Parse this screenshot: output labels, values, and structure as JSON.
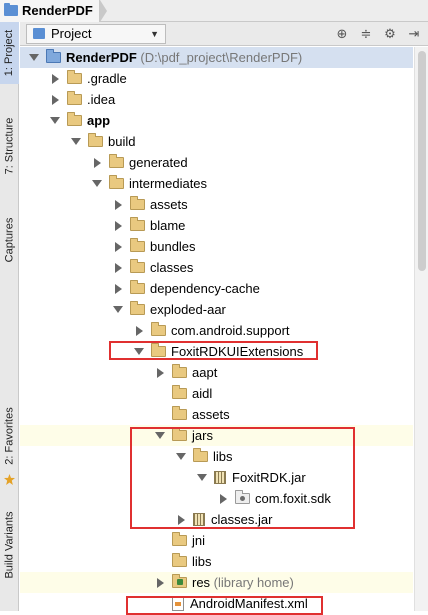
{
  "breadcrumb": {
    "label": "RenderPDF"
  },
  "left_tabs": {
    "project": "1: Project",
    "structure": "7: Structure",
    "captures": "Captures",
    "favorites": "2: Favorites",
    "build_variants": "Build Variants"
  },
  "header": {
    "view": "Project"
  },
  "tree": [
    {
      "label": "RenderPDF",
      "suffix": " (D:\\pdf_project\\RenderPDF)",
      "icon": "blue",
      "arrow": "down",
      "level": 0,
      "bold": true,
      "selected": true
    },
    {
      "label": ".gradle",
      "icon": "folder",
      "arrow": "right",
      "level": 1
    },
    {
      "label": ".idea",
      "icon": "folder",
      "arrow": "right",
      "level": 1
    },
    {
      "label": "app",
      "icon": "folder",
      "arrow": "down",
      "level": 1,
      "bold": true
    },
    {
      "label": "build",
      "icon": "folder",
      "arrow": "down",
      "level": 2
    },
    {
      "label": "generated",
      "icon": "folder",
      "arrow": "right",
      "level": 3
    },
    {
      "label": "intermediates",
      "icon": "folder",
      "arrow": "down",
      "level": 3
    },
    {
      "label": "assets",
      "icon": "folder",
      "arrow": "right",
      "level": 4
    },
    {
      "label": "blame",
      "icon": "folder",
      "arrow": "right",
      "level": 4
    },
    {
      "label": "bundles",
      "icon": "folder",
      "arrow": "right",
      "level": 4
    },
    {
      "label": "classes",
      "icon": "folder",
      "arrow": "right",
      "level": 4
    },
    {
      "label": "dependency-cache",
      "icon": "folder",
      "arrow": "right",
      "level": 4
    },
    {
      "label": "exploded-aar",
      "icon": "folder",
      "arrow": "down",
      "level": 4
    },
    {
      "label": "com.android.support",
      "icon": "folder",
      "arrow": "right",
      "level": 5
    },
    {
      "label": "FoxitRDKUIExtensions",
      "icon": "folder",
      "arrow": "down",
      "level": 5
    },
    {
      "label": "aapt",
      "icon": "folder",
      "arrow": "right",
      "level": 6
    },
    {
      "label": "aidl",
      "icon": "folder",
      "arrow": "none",
      "level": 6
    },
    {
      "label": "assets",
      "icon": "folder",
      "arrow": "none",
      "level": 6
    },
    {
      "label": "jars",
      "icon": "folder",
      "arrow": "down",
      "level": 6,
      "tint": true
    },
    {
      "label": "libs",
      "icon": "folder",
      "arrow": "down",
      "level": 7
    },
    {
      "label": "FoxitRDK.jar",
      "icon": "jar",
      "arrow": "down",
      "level": 8
    },
    {
      "label": "com.foxit.sdk",
      "icon": "pkg",
      "arrow": "right",
      "level": 9
    },
    {
      "label": "classes.jar",
      "icon": "jar",
      "arrow": "right",
      "level": 7
    },
    {
      "label": "jni",
      "icon": "folder",
      "arrow": "none",
      "level": 6
    },
    {
      "label": "libs",
      "icon": "folder",
      "arrow": "none",
      "level": 6
    },
    {
      "label": "res",
      "suffix": " (library home)",
      "icon": "res",
      "arrow": "right",
      "level": 6,
      "tint": true
    },
    {
      "label": "AndroidManifest.xml",
      "icon": "xml",
      "arrow": "none",
      "level": 6
    }
  ]
}
